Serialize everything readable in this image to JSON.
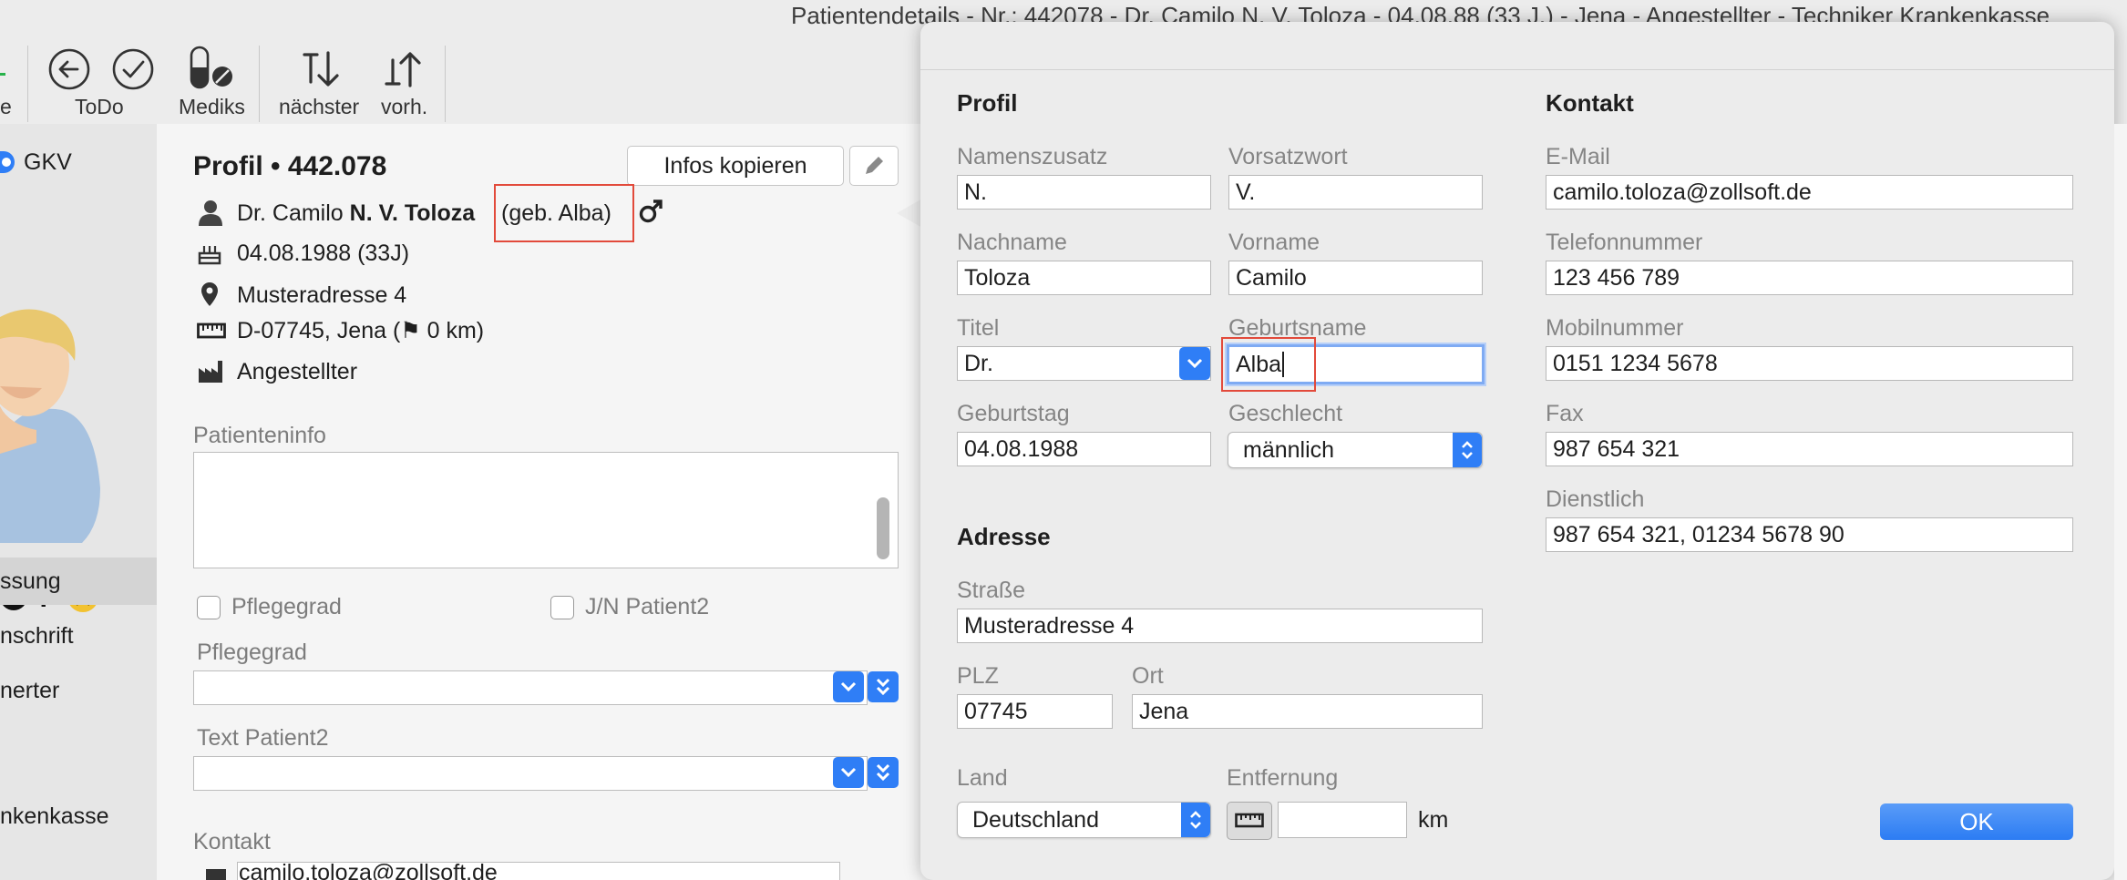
{
  "window": {
    "title": "Patientendetails - Nr.: 442078 - Dr. Camilo N. V. Toloza - 04.08.88 (33 J.) - Jena - Angestellter - Techniker Krankenkasse"
  },
  "toolbar": {
    "partial_label": "e",
    "todo_label": "ToDo",
    "mediks_label": "Mediks",
    "next_label": "nächster",
    "prev_label": "vorh."
  },
  "sidebar": {
    "insurance": "GKV",
    "items": [
      "ssung",
      "nschrift",
      "nerter",
      "nkenkasse"
    ]
  },
  "profile": {
    "title": "Profil • 442.078",
    "copy_button": "Infos kopieren",
    "name_prefix": "Dr. Camilo ",
    "name_bold": "N. V. Toloza",
    "birth_name": "(geb. Alba)",
    "birthday": "04.08.1988 (33J)",
    "street": "Musteradresse 4",
    "city": "D-07745, Jena (⚑ 0 km)",
    "occupation": "Angestellter",
    "patient_info_label": "Patienteninfo",
    "patient_info_value": "",
    "checkbox_pflegegrad": "Pflegegrad",
    "checkbox_patient2": "J/N Patient2",
    "pflegegrad_label": "Pflegegrad",
    "pflegegrad_value": "",
    "text_patient2_label": "Text Patient2",
    "text_patient2_value": "",
    "contact_label": "Kontakt",
    "contact_email_partial": "camilo.toloza@zollsoft.de"
  },
  "edit_popover": {
    "profil_heading": "Profil",
    "namenszusatz_label": "Namenszusatz",
    "namenszusatz": "N.",
    "vorsatzwort_label": "Vorsatzwort",
    "vorsatzwort": "V.",
    "nachname_label": "Nachname",
    "nachname": "Toloza",
    "vorname_label": "Vorname",
    "vorname": "Camilo",
    "titel_label": "Titel",
    "titel": "Dr.",
    "geburtsname_label": "Geburtsname",
    "geburtsname": "Alba",
    "geburtstag_label": "Geburtstag",
    "geburtstag": "04.08.1988",
    "geschlecht_label": "Geschlecht",
    "geschlecht": "männlich",
    "adresse_heading": "Adresse",
    "strasse_label": "Straße",
    "strasse": "Musteradresse 4",
    "plz_label": "PLZ",
    "plz": "07745",
    "ort_label": "Ort",
    "ort": "Jena",
    "land_label": "Land",
    "land": "Deutschland",
    "entfernung_label": "Entfernung",
    "entfernung": "",
    "entfernung_unit": "km",
    "kontakt_heading": "Kontakt",
    "email_label": "E-Mail",
    "email": "camilo.toloza@zollsoft.de",
    "telefon_label": "Telefonnummer",
    "telefon": "123 456 789",
    "mobil_label": "Mobilnummer",
    "mobil": "0151 1234 5678",
    "fax_label": "Fax",
    "fax": "987 654 321",
    "dienstlich_label": "Dienstlich",
    "dienstlich": "987 654 321, 01234 5678 90",
    "ok_button": "OK"
  },
  "colors": {
    "accent": "#2f7ef6",
    "highlight": "#e24a3b",
    "focus_ring": "#7fabf3"
  }
}
